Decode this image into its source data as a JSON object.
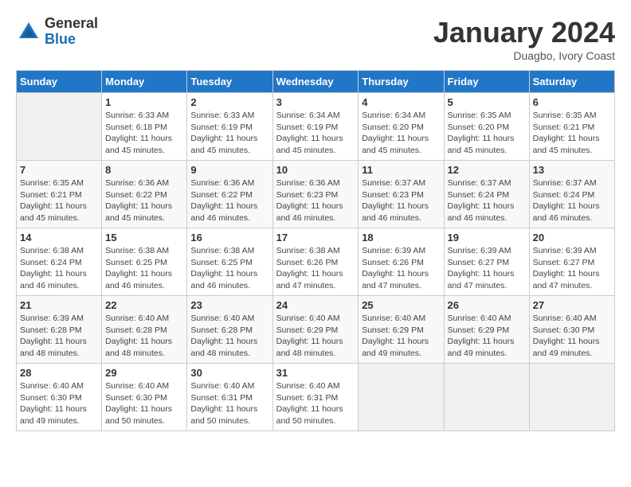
{
  "header": {
    "logo_general": "General",
    "logo_blue": "Blue",
    "month_title": "January 2024",
    "subtitle": "Duagbo, Ivory Coast"
  },
  "days_of_week": [
    "Sunday",
    "Monday",
    "Tuesday",
    "Wednesday",
    "Thursday",
    "Friday",
    "Saturday"
  ],
  "weeks": [
    [
      {
        "day": "",
        "info": ""
      },
      {
        "day": "1",
        "info": "Sunrise: 6:33 AM\nSunset: 6:18 PM\nDaylight: 11 hours and 45 minutes."
      },
      {
        "day": "2",
        "info": "Sunrise: 6:33 AM\nSunset: 6:19 PM\nDaylight: 11 hours and 45 minutes."
      },
      {
        "day": "3",
        "info": "Sunrise: 6:34 AM\nSunset: 6:19 PM\nDaylight: 11 hours and 45 minutes."
      },
      {
        "day": "4",
        "info": "Sunrise: 6:34 AM\nSunset: 6:20 PM\nDaylight: 11 hours and 45 minutes."
      },
      {
        "day": "5",
        "info": "Sunrise: 6:35 AM\nSunset: 6:20 PM\nDaylight: 11 hours and 45 minutes."
      },
      {
        "day": "6",
        "info": "Sunrise: 6:35 AM\nSunset: 6:21 PM\nDaylight: 11 hours and 45 minutes."
      }
    ],
    [
      {
        "day": "7",
        "info": "Sunrise: 6:35 AM\nSunset: 6:21 PM\nDaylight: 11 hours and 45 minutes."
      },
      {
        "day": "8",
        "info": "Sunrise: 6:36 AM\nSunset: 6:22 PM\nDaylight: 11 hours and 45 minutes."
      },
      {
        "day": "9",
        "info": "Sunrise: 6:36 AM\nSunset: 6:22 PM\nDaylight: 11 hours and 46 minutes."
      },
      {
        "day": "10",
        "info": "Sunrise: 6:36 AM\nSunset: 6:23 PM\nDaylight: 11 hours and 46 minutes."
      },
      {
        "day": "11",
        "info": "Sunrise: 6:37 AM\nSunset: 6:23 PM\nDaylight: 11 hours and 46 minutes."
      },
      {
        "day": "12",
        "info": "Sunrise: 6:37 AM\nSunset: 6:24 PM\nDaylight: 11 hours and 46 minutes."
      },
      {
        "day": "13",
        "info": "Sunrise: 6:37 AM\nSunset: 6:24 PM\nDaylight: 11 hours and 46 minutes."
      }
    ],
    [
      {
        "day": "14",
        "info": "Sunrise: 6:38 AM\nSunset: 6:24 PM\nDaylight: 11 hours and 46 minutes."
      },
      {
        "day": "15",
        "info": "Sunrise: 6:38 AM\nSunset: 6:25 PM\nDaylight: 11 hours and 46 minutes."
      },
      {
        "day": "16",
        "info": "Sunrise: 6:38 AM\nSunset: 6:25 PM\nDaylight: 11 hours and 46 minutes."
      },
      {
        "day": "17",
        "info": "Sunrise: 6:38 AM\nSunset: 6:26 PM\nDaylight: 11 hours and 47 minutes."
      },
      {
        "day": "18",
        "info": "Sunrise: 6:39 AM\nSunset: 6:26 PM\nDaylight: 11 hours and 47 minutes."
      },
      {
        "day": "19",
        "info": "Sunrise: 6:39 AM\nSunset: 6:27 PM\nDaylight: 11 hours and 47 minutes."
      },
      {
        "day": "20",
        "info": "Sunrise: 6:39 AM\nSunset: 6:27 PM\nDaylight: 11 hours and 47 minutes."
      }
    ],
    [
      {
        "day": "21",
        "info": "Sunrise: 6:39 AM\nSunset: 6:28 PM\nDaylight: 11 hours and 48 minutes."
      },
      {
        "day": "22",
        "info": "Sunrise: 6:40 AM\nSunset: 6:28 PM\nDaylight: 11 hours and 48 minutes."
      },
      {
        "day": "23",
        "info": "Sunrise: 6:40 AM\nSunset: 6:28 PM\nDaylight: 11 hours and 48 minutes."
      },
      {
        "day": "24",
        "info": "Sunrise: 6:40 AM\nSunset: 6:29 PM\nDaylight: 11 hours and 48 minutes."
      },
      {
        "day": "25",
        "info": "Sunrise: 6:40 AM\nSunset: 6:29 PM\nDaylight: 11 hours and 49 minutes."
      },
      {
        "day": "26",
        "info": "Sunrise: 6:40 AM\nSunset: 6:29 PM\nDaylight: 11 hours and 49 minutes."
      },
      {
        "day": "27",
        "info": "Sunrise: 6:40 AM\nSunset: 6:30 PM\nDaylight: 11 hours and 49 minutes."
      }
    ],
    [
      {
        "day": "28",
        "info": "Sunrise: 6:40 AM\nSunset: 6:30 PM\nDaylight: 11 hours and 49 minutes."
      },
      {
        "day": "29",
        "info": "Sunrise: 6:40 AM\nSunset: 6:30 PM\nDaylight: 11 hours and 50 minutes."
      },
      {
        "day": "30",
        "info": "Sunrise: 6:40 AM\nSunset: 6:31 PM\nDaylight: 11 hours and 50 minutes."
      },
      {
        "day": "31",
        "info": "Sunrise: 6:40 AM\nSunset: 6:31 PM\nDaylight: 11 hours and 50 minutes."
      },
      {
        "day": "",
        "info": ""
      },
      {
        "day": "",
        "info": ""
      },
      {
        "day": "",
        "info": ""
      }
    ]
  ]
}
